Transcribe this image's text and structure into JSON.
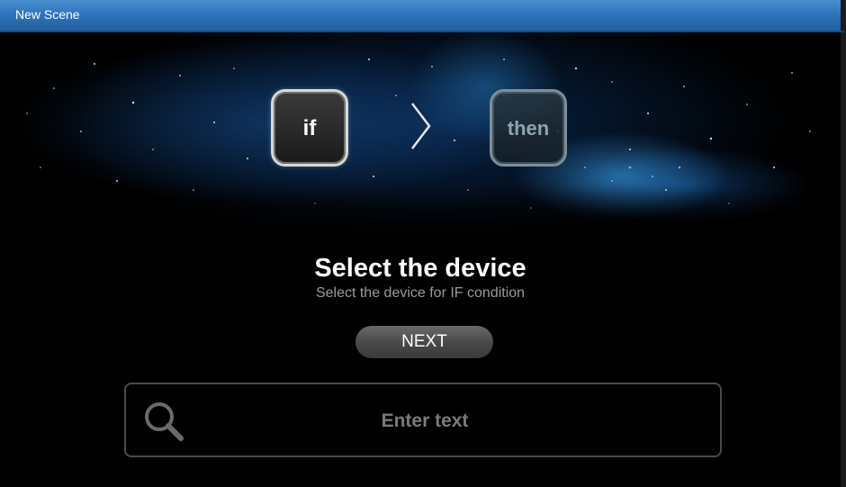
{
  "window": {
    "title": "New Scene"
  },
  "steps": {
    "if_label": "if",
    "then_label": "then",
    "separator_icon": "chevron-right-icon"
  },
  "main": {
    "heading": "Select the device",
    "subheading": "Select the device for IF condition",
    "next_label": "NEXT"
  },
  "search": {
    "icon": "search-icon",
    "placeholder": "Enter text",
    "value": ""
  },
  "colors": {
    "titlebar": "#2f74bb",
    "background": "#000000",
    "accent_glow": "#3aa0ff"
  }
}
